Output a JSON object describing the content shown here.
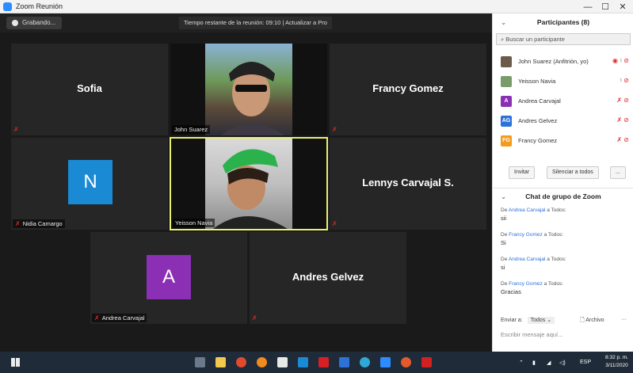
{
  "window": {
    "title": "Zoom Reunión",
    "minimize": "—",
    "maximize": "☐",
    "close": "✕"
  },
  "meeting": {
    "recording_label": "Grabando...",
    "timer_text": "Tiempo restante de la reunión: 09:10 | Actualizar a Pro"
  },
  "tiles": {
    "sofia": {
      "name": "Sofia"
    },
    "john": {
      "label": "John Suarez"
    },
    "francy": {
      "name": "Francy Gomez"
    },
    "nidia": {
      "avatar_letter": "N",
      "label": "Nidia Camargo",
      "avatar_color": "#1a8ad4"
    },
    "yeisson": {
      "label": "Yeisson Navia"
    },
    "lennys": {
      "name": "Lennys Carvajal S."
    },
    "andrea": {
      "avatar_letter": "A",
      "label": "Andrea Carvajal",
      "avatar_color": "#8b2fb5"
    },
    "andres": {
      "name": "Andres Gelvez"
    }
  },
  "participants_panel": {
    "title": "Participantes (8)",
    "search_placeholder": "Buscar un participante",
    "items": [
      {
        "name": "John Suarez (Anfitrión, yo)",
        "avatar": "photo",
        "mic": "on"
      },
      {
        "name": "Yeisson Navia",
        "avatar": "photo",
        "mic": "on"
      },
      {
        "name": "Andrea Carvajal",
        "avatar": "A",
        "color": "#8b2fb5",
        "mic": "muted"
      },
      {
        "name": "Andres Gelvez",
        "avatar": "AG",
        "color": "#2d72d9",
        "mic": "muted"
      },
      {
        "name": "Francy Gomez",
        "avatar": "FG",
        "color": "#f29b1d",
        "mic": "muted"
      }
    ],
    "invite_label": "Invitar",
    "mute_all_label": "Silenciar a todos",
    "more_label": "..."
  },
  "chat": {
    "title": "Chat de grupo de Zoom",
    "messages": [
      {
        "prefix": "De",
        "from": "Andrea Carvajal",
        "suffix": "a Todos:",
        "text": "sii"
      },
      {
        "prefix": "De",
        "from": "Francy Gomez",
        "suffix": "a Todos:",
        "text": "Si"
      },
      {
        "prefix": "De",
        "from": "Andrea Carvajal",
        "suffix": "a Todos:",
        "text": "si"
      },
      {
        "prefix": "De",
        "from": "Francy Gomez",
        "suffix": "a Todos:",
        "text": "Gracias"
      }
    ],
    "send_to_label": "Enviar a:",
    "send_to_value": "Todos",
    "file_label": "Archivo",
    "compose_placeholder": "Escribir mensaje aquí..."
  },
  "taskbar": {
    "language": "ESP",
    "time": "8:32 p. m.",
    "date": "3/11/2020"
  },
  "colors": {
    "accent": "#2d8cff",
    "muted_red": "#e02828",
    "active_speaker": "#e8f06c"
  }
}
